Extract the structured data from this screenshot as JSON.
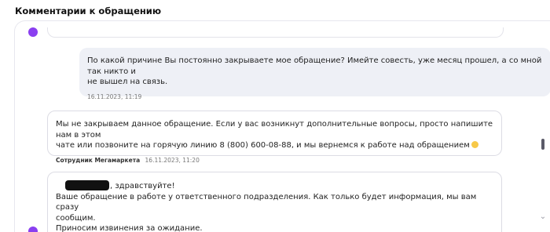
{
  "section": {
    "title": "Комментарии к обращению"
  },
  "messages": [
    {
      "kind": "user",
      "text": "По какой причине Вы постоянно закрываете мое обращение? Имейте совесть, уже месяц прошел, а со мной так никто и\nне вышел на связь.",
      "author": "",
      "timestamp": "16.11.2023, 11:19"
    },
    {
      "kind": "support",
      "text": "Мы не закрываем данное обращение. Если у вас возникнут дополнительные вопросы, просто напишите нам в этом\nчате или позвоните на горячую линию 8 (800) 600-08-88, и мы вернемся к работе над обращением",
      "emoji": "smile-emoji",
      "author": "Сотрудник Мегамаркета",
      "timestamp": "16.11.2023, 11:20"
    },
    {
      "kind": "agent",
      "greeting": ", здравствуйте!",
      "body": "Ваше обращение в работе у ответственного подразделения. Как только будет информация, мы вам сразу\nсообщим.\nПриносим извинения за ожидание."
    }
  ],
  "icons": {
    "avatar": "avatar-dot",
    "scroll": "chevron-down-icon"
  },
  "colors": {
    "accent": "#8a3ff0",
    "user_bubble": "#eef0f6",
    "border": "#dcdce4"
  }
}
